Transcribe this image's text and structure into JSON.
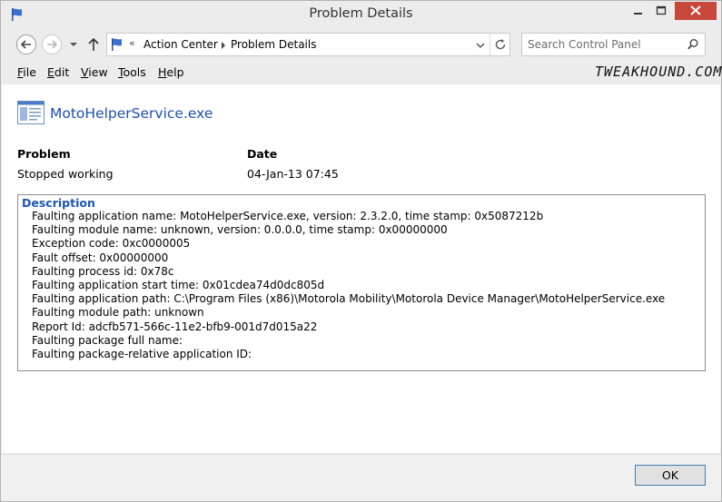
{
  "window": {
    "title": "Problem Details"
  },
  "address": {
    "overflow": "«",
    "crumbs": [
      "Action Center",
      "Problem Details"
    ]
  },
  "search": {
    "placeholder": "Search Control Panel"
  },
  "menu": {
    "items": [
      {
        "accel": "F",
        "rest": "ile"
      },
      {
        "accel": "E",
        "rest": "dit"
      },
      {
        "accel": "V",
        "rest": "iew"
      },
      {
        "accel": "T",
        "rest": "ools"
      },
      {
        "accel": "H",
        "rest": "elp"
      }
    ],
    "watermark": "TWEAKHOUND.COM"
  },
  "problem": {
    "app_name": "MotoHelperService.exe",
    "problem_label": "Problem",
    "problem_value": "Stopped working",
    "date_label": "Date",
    "date_value": "04-Jan-13 07:45"
  },
  "description": {
    "title": "Description",
    "lines": [
      "Faulting application name: MotoHelperService.exe, version: 2.3.2.0, time stamp: 0x5087212b",
      "Faulting module name: unknown, version: 0.0.0.0, time stamp: 0x00000000",
      "Exception code: 0xc0000005",
      "Fault offset: 0x00000000",
      "Faulting process id: 0x78c",
      "Faulting application start time: 0x01cdea74d0dc805d",
      "Faulting application path: C:\\Program Files (x86)\\Motorola Mobility\\Motorola Device Manager\\MotoHelperService.exe",
      "Faulting module path: unknown",
      "Report Id: adcfb571-566c-11e2-bfb9-001d7d015a22",
      "Faulting package full name:",
      "Faulting package-relative application ID:"
    ]
  },
  "footer": {
    "ok_label": "OK"
  },
  "icons": {
    "app": "action-center-flag-icon",
    "back": "back-arrow-icon",
    "forward": "forward-arrow-icon",
    "recent": "chevron-down-icon",
    "up": "up-arrow-icon",
    "refresh": "refresh-icon",
    "search": "search-icon",
    "document": "document-icon"
  },
  "colors": {
    "close_button": "#c7473b",
    "link_blue": "#1e4fb5",
    "focus_border": "#3c7fb1"
  }
}
